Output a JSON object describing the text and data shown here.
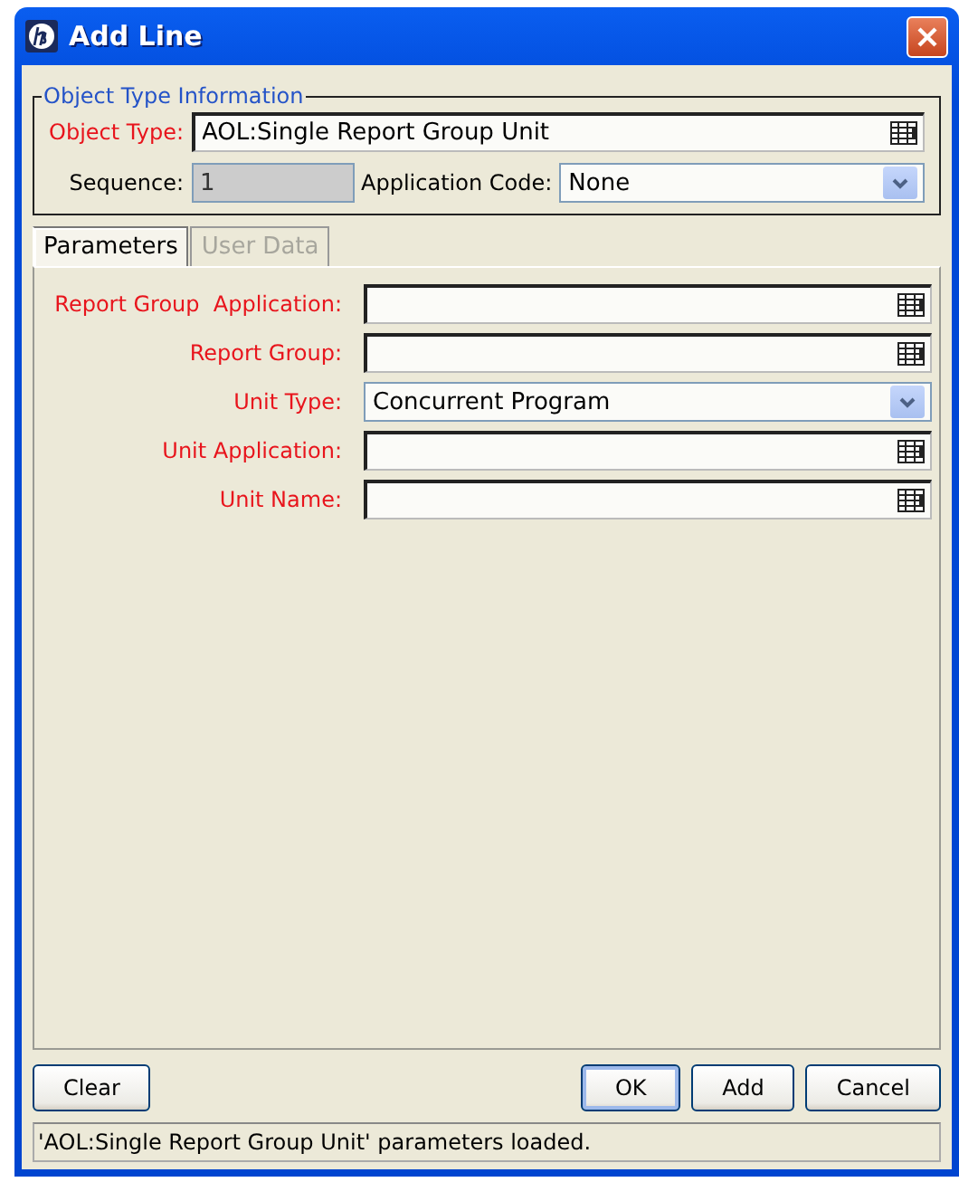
{
  "window": {
    "title": "Add Line"
  },
  "object_type_information": {
    "title": "Object Type Information",
    "object_type": {
      "label": "Object Type:",
      "required": true,
      "kind": "lookup",
      "value": "AOL:Single Report Group Unit"
    },
    "sequence": {
      "label": "Sequence:",
      "required": false,
      "kind": "readonly",
      "value": "1"
    },
    "application_code": {
      "label": "Application Code:",
      "required": false,
      "kind": "dropdown",
      "value": "None"
    }
  },
  "tabs": [
    {
      "label": "Parameters",
      "selected": true,
      "disabled": false
    },
    {
      "label": "User Data",
      "selected": false,
      "disabled": true
    }
  ],
  "parameters": [
    {
      "label": "Report Group  Application:",
      "required": true,
      "kind": "lookup"
    },
    {
      "label": "Report Group:",
      "required": true,
      "kind": "lookup"
    },
    {
      "label": "Unit Type:",
      "required": true,
      "kind": "dropdown",
      "value": "Concurrent Program"
    },
    {
      "label": "Unit Application:",
      "required": true,
      "kind": "lookup"
    },
    {
      "label": "Unit Name:",
      "required": true,
      "kind": "lookup"
    }
  ],
  "buttons_left": [
    {
      "label": "Clear",
      "default": false
    }
  ],
  "buttons_right": [
    {
      "label": "OK",
      "default": true
    },
    {
      "label": "Add",
      "default": false
    },
    {
      "label": "Cancel",
      "default": false
    }
  ],
  "status_bar": "'AOL:Single Report Group Unit' parameters loaded."
}
